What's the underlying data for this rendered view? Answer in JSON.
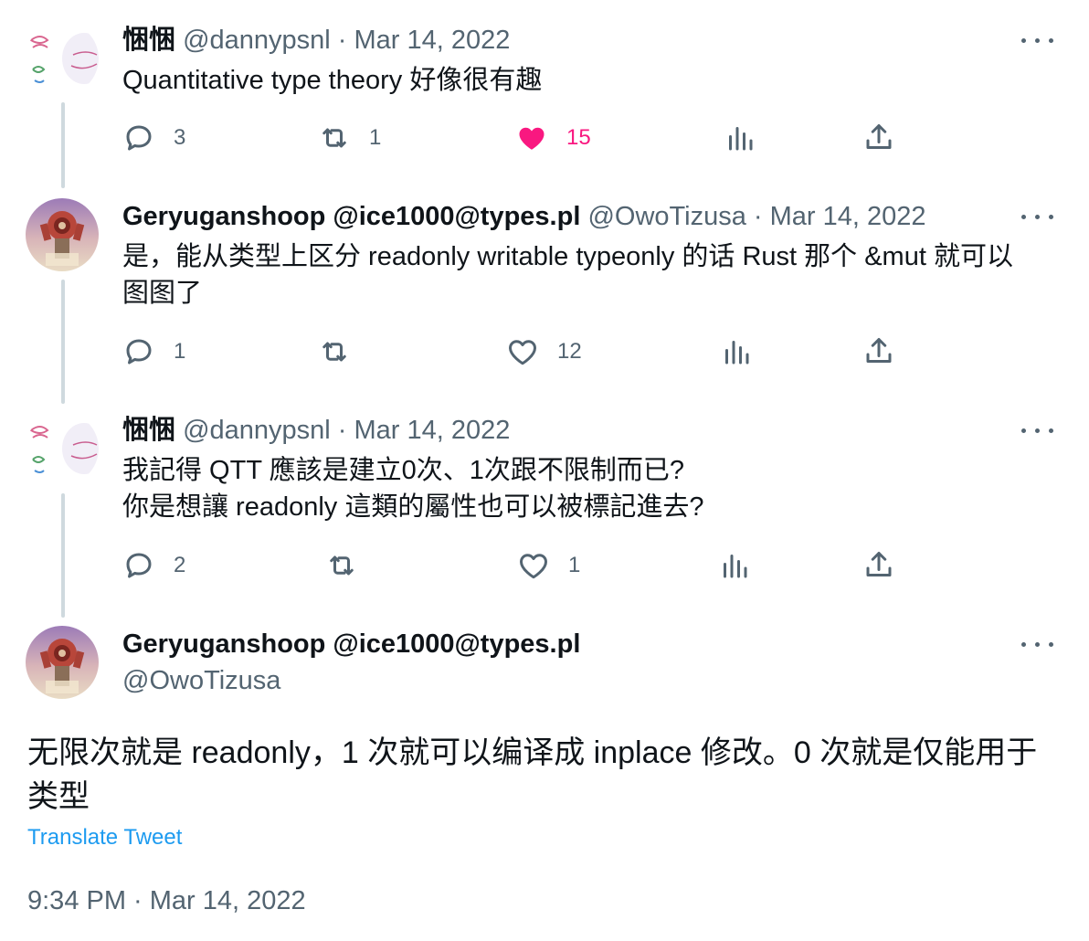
{
  "tweets": [
    {
      "name": "悃悃",
      "meta": "@dannypsnl · Mar 14, 2022",
      "lines": [
        "Quantitative type theory 好像很有趣"
      ],
      "replies": "3",
      "retweets": "1",
      "likes": "15",
      "liked": true
    },
    {
      "name": "Geryuganshoop @ice1000@types.pl",
      "meta": "@OwoTizusa · Mar 14, 2022",
      "lines": [
        "是，能从类型上区分 readonly writable typeonly 的话 Rust 那个 &mut 就可以",
        "图图了"
      ],
      "replies": "1",
      "retweets": "",
      "likes": "12",
      "liked": false
    },
    {
      "name": "悃悃",
      "meta": "@dannypsnl · Mar 14, 2022",
      "lines": [
        "我記得 QTT 應該是建立0次、1次跟不限制而已?",
        "你是想讓 readonly 這類的屬性也可以被標記進去?"
      ],
      "replies": "2",
      "retweets": "",
      "likes": "1",
      "liked": false
    }
  ],
  "main_tweet": {
    "name": "Geryuganshoop @ice1000@types.pl",
    "handle": "@OwoTizusa",
    "lines": [
      "无限次就是 readonly，1 次就可以编译成 inplace 修改。0 次就是仅能用于",
      "类型"
    ],
    "translate_label": "Translate Tweet",
    "timestamp": "9:34 PM · Mar 14, 2022"
  },
  "icons": {
    "reply": "reply-icon",
    "retweet": "retweet-icon",
    "like": "heart-icon",
    "views": "analytics-icon",
    "share": "share-icon",
    "more": "more-options-icon"
  },
  "colors": {
    "text": "#0f1419",
    "secondary": "#536471",
    "like": "#f91880",
    "link": "#1d9bf0"
  }
}
